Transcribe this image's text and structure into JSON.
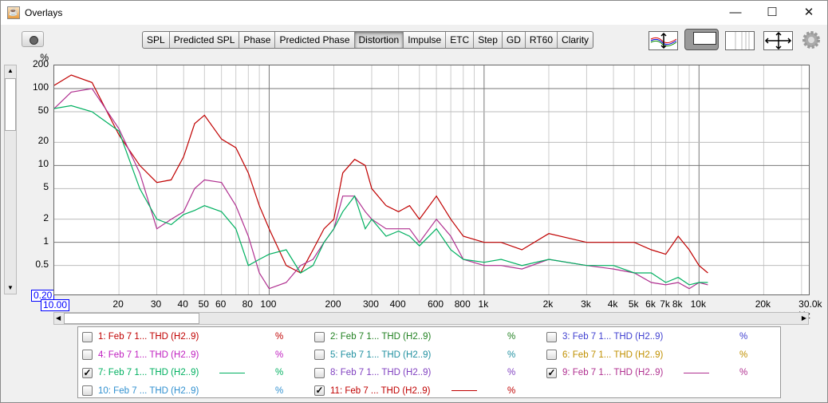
{
  "window": {
    "title": "Overlays",
    "minimize": "—",
    "maximize": "☐",
    "close": "✕"
  },
  "tabs": [
    {
      "label": "SPL"
    },
    {
      "label": "Predicted SPL"
    },
    {
      "label": "Phase"
    },
    {
      "label": "Predicted Phase"
    },
    {
      "label": "Distortion",
      "active": true
    },
    {
      "label": "Impulse"
    },
    {
      "label": "ETC"
    },
    {
      "label": "Step"
    },
    {
      "label": "GD"
    },
    {
      "label": "RT60"
    },
    {
      "label": "Clarity"
    }
  ],
  "toolbar_icons": [
    "vertical-scale-icon",
    "zoom-view-icon",
    "grid-lines-icon",
    "fit-all-icon",
    "gear-icon"
  ],
  "chart_data": {
    "type": "line",
    "ylabel": "%",
    "xlabel": "Hz",
    "xscale": "log",
    "yscale": "log",
    "xlim": [
      10,
      33000
    ],
    "ylim": [
      0.2,
      200
    ],
    "grid": true,
    "yticks": [
      "200",
      "100",
      "50",
      "20",
      "10",
      "5",
      "2",
      "1",
      "0.5"
    ],
    "xticks": [
      "20",
      "30",
      "40",
      "50",
      "60",
      "80",
      "100",
      "200",
      "300",
      "400",
      "600",
      "800",
      "1k",
      "2k",
      "3k",
      "4k",
      "5k",
      "6k",
      "7k",
      "8k",
      "10k",
      "20k",
      "30.0k Hz"
    ],
    "ymin_readout": "0.20",
    "xmin_readout": "10.00",
    "x": [
      10,
      12,
      15,
      20,
      25,
      30,
      35,
      40,
      45,
      50,
      60,
      70,
      80,
      90,
      100,
      120,
      140,
      160,
      180,
      200,
      220,
      250,
      280,
      300,
      350,
      400,
      450,
      500,
      600,
      700,
      800,
      1000,
      1200,
      1500,
      2000,
      3000,
      4000,
      5000,
      6000,
      7000,
      8000,
      9000,
      10000,
      11000
    ],
    "series": [
      {
        "legend": "11",
        "color": "#c00000",
        "values": [
          110,
          150,
          120,
          25,
          10,
          6,
          6.5,
          13,
          35,
          45,
          22,
          17,
          8,
          3,
          1.5,
          0.5,
          0.4,
          0.8,
          1.5,
          2,
          8,
          12,
          10,
          5,
          3,
          2.5,
          3,
          2,
          4,
          2,
          1.2,
          1,
          1,
          0.8,
          1.3,
          1,
          1,
          1,
          0.8,
          0.7,
          1.2,
          0.8,
          0.5,
          0.4
        ]
      },
      {
        "legend": "9",
        "color": "#b03090",
        "values": [
          55,
          90,
          100,
          30,
          8,
          1.5,
          2,
          2.5,
          5,
          6.5,
          6,
          3,
          1.2,
          0.4,
          0.25,
          0.3,
          0.5,
          0.6,
          1,
          1.5,
          4,
          4,
          2.5,
          2,
          1.5,
          1.5,
          1.5,
          1,
          2,
          1.2,
          0.6,
          0.5,
          0.5,
          0.45,
          0.6,
          0.5,
          0.45,
          0.4,
          0.3,
          0.28,
          0.3,
          0.25,
          0.3,
          0.28
        ]
      },
      {
        "legend": "7",
        "color": "#00b060",
        "values": [
          55,
          60,
          50,
          28,
          5,
          2,
          1.7,
          2.3,
          2.6,
          3,
          2.5,
          1.5,
          0.5,
          0.6,
          0.7,
          0.8,
          0.4,
          0.5,
          1,
          1.5,
          2.5,
          4,
          1.5,
          2,
          1.2,
          1.4,
          1.2,
          0.9,
          1.5,
          0.8,
          0.6,
          0.55,
          0.6,
          0.5,
          0.6,
          0.5,
          0.5,
          0.4,
          0.4,
          0.3,
          0.35,
          0.28,
          0.3,
          0.3
        ]
      }
    ]
  },
  "legend": [
    {
      "name": "1: Feb 7 1... THD (H2..9)",
      "unit": "%",
      "color": "#c00000",
      "checked": false
    },
    {
      "name": "2: Feb 7 1... THD (H2..9)",
      "unit": "%",
      "color": "#208020",
      "checked": false
    },
    {
      "name": "3: Feb 7 1... THD (H2..9)",
      "unit": "%",
      "color": "#4040d0",
      "checked": false
    },
    {
      "name": "4: Feb 7 1... THD (H2..9)",
      "unit": "%",
      "color": "#c020c0",
      "checked": false
    },
    {
      "name": "5: Feb 7 1... THD (H2..9)",
      "unit": "%",
      "color": "#2090a0",
      "checked": false
    },
    {
      "name": "6: Feb 7 1... THD (H2..9)",
      "unit": "%",
      "color": "#c09000",
      "checked": false
    },
    {
      "name": "7: Feb 7 1... THD (H2..9)",
      "unit": "%",
      "color": "#00b060",
      "checked": true
    },
    {
      "name": "8: Feb 7 1... THD (H2..9)",
      "unit": "%",
      "color": "#8040c0",
      "checked": false
    },
    {
      "name": "9: Feb 7 1... THD (H2..9)",
      "unit": "%",
      "color": "#b03090",
      "checked": true
    },
    {
      "name": "10: Feb 7 ... THD (H2..9)",
      "unit": "%",
      "color": "#3090d0",
      "checked": false
    },
    {
      "name": "11: Feb 7 ... THD (H2..9)",
      "unit": "%",
      "color": "#c00000",
      "checked": true
    }
  ]
}
